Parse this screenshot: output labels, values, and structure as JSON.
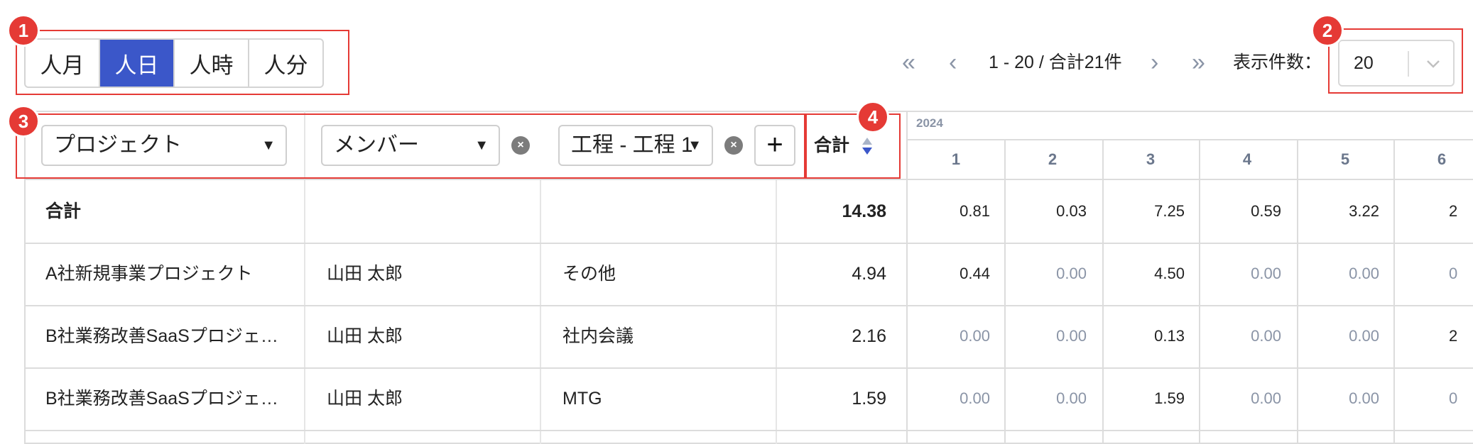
{
  "badges": [
    "1",
    "2",
    "3",
    "4"
  ],
  "unit_toggle": {
    "options": [
      "人月",
      "人日",
      "人時",
      "人分"
    ],
    "active_index": 1
  },
  "pagination": {
    "range_text": "1 - 20 / 合計21件",
    "per_page_label": "表示件数：",
    "per_page_value": "20"
  },
  "group_by": {
    "dropdowns": [
      "プロジェクト",
      "メンバー",
      "工程 - 工程 1"
    ],
    "add_label": "+"
  },
  "total_header": "合計",
  "year": "2024",
  "months": [
    "1",
    "2",
    "3",
    "4",
    "5",
    "6"
  ],
  "rows": [
    {
      "project": "合計",
      "member": "",
      "process": "",
      "total": "14.38",
      "months": [
        "0.81",
        "0.03",
        "7.25",
        "0.59",
        "3.22",
        "2"
      ]
    },
    {
      "project": "A社新規事業プロジェクト",
      "member": "山田 太郎",
      "process": "その他",
      "total": "4.94",
      "months": [
        "0.44",
        "0.00",
        "4.50",
        "0.00",
        "0.00",
        "0"
      ]
    },
    {
      "project": "B社業務改善SaaSプロジェ…",
      "member": "山田 太郎",
      "process": "社内会議",
      "total": "2.16",
      "months": [
        "0.00",
        "0.00",
        "0.13",
        "0.00",
        "0.00",
        "2"
      ]
    },
    {
      "project": "B社業務改善SaaSプロジェ…",
      "member": "山田 太郎",
      "process": "MTG",
      "total": "1.59",
      "months": [
        "0.00",
        "0.00",
        "1.59",
        "0.00",
        "0.00",
        "0"
      ]
    }
  ],
  "colors": {
    "accent": "#3b57c9",
    "callout": "#e53a35",
    "muted": "#8a94a6"
  }
}
